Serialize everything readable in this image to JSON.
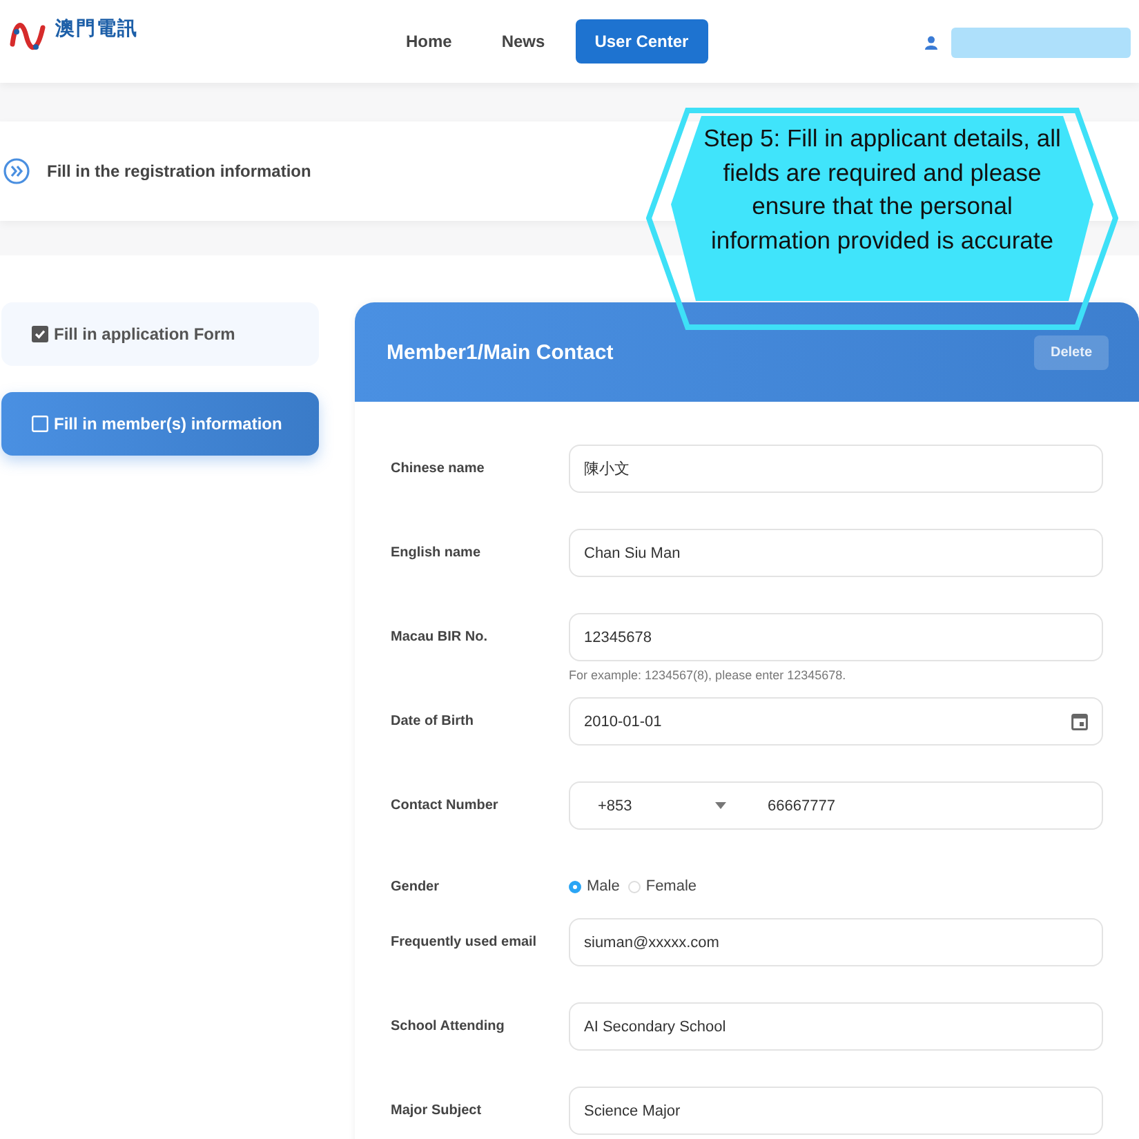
{
  "header": {
    "logo_text": "澳門電訊",
    "nav": [
      {
        "label": "Home",
        "selected": false
      },
      {
        "label": "News",
        "selected": false
      },
      {
        "label": "User Center",
        "selected": true
      }
    ]
  },
  "step_bar": {
    "title": "Fill in the registration information"
  },
  "callout": {
    "text": "Step 5: Fill in applicant details, all fields are required and please ensure that the personal information provided is accurate"
  },
  "sidebar": {
    "items": [
      {
        "label": "Fill in application Form",
        "checked": true,
        "selected": false
      },
      {
        "label": "Fill in member(s) information",
        "checked": false,
        "selected": true
      }
    ]
  },
  "card": {
    "title": "Member1/Main Contact",
    "delete_button": "Delete",
    "fields": [
      {
        "kind": "text",
        "label": "Chinese name",
        "value": "陳小文"
      },
      {
        "kind": "text",
        "label": "English name",
        "value": "Chan Siu Man"
      },
      {
        "kind": "text",
        "label": "Macau BIR No.",
        "value": "12345678",
        "hint": "For example: 1234567(8), please enter 12345678."
      },
      {
        "kind": "date",
        "label": "Date of Birth",
        "value": "2010-01-01"
      },
      {
        "kind": "phone",
        "label": "Contact Number",
        "code": "+853",
        "value": "66667777"
      },
      {
        "kind": "radio",
        "label": "Gender",
        "options": [
          {
            "label": "Male",
            "selected": true
          },
          {
            "label": "Female",
            "selected": false
          }
        ]
      },
      {
        "kind": "text",
        "label": "Frequently used email",
        "value": "siuman@xxxxx.com"
      },
      {
        "kind": "text",
        "label": "School Attending",
        "value": "AI Secondary School"
      },
      {
        "kind": "text",
        "label": "Major Subject",
        "value": "Science Major"
      }
    ]
  }
}
